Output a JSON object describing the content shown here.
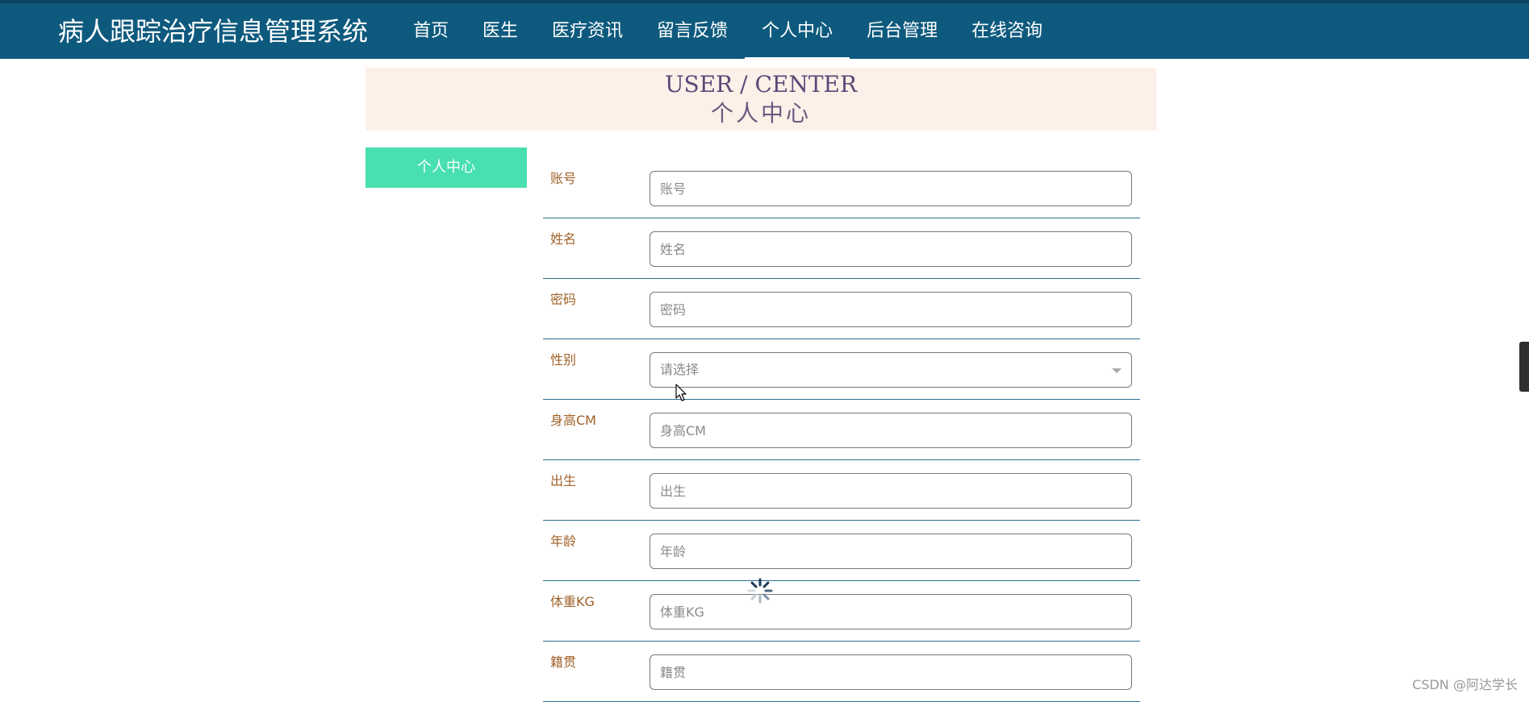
{
  "header": {
    "title": "病人跟踪治疗信息管理系统",
    "nav": [
      {
        "label": "首页"
      },
      {
        "label": "医生"
      },
      {
        "label": "医疗资讯"
      },
      {
        "label": "留言反馈"
      },
      {
        "label": "个人中心"
      },
      {
        "label": "后台管理"
      },
      {
        "label": "在线咨询"
      }
    ],
    "active_nav": "个人中心"
  },
  "banner": {
    "title_en": "USER / CENTER",
    "title_cn": "个人中心"
  },
  "side_menu": {
    "items": [
      {
        "label": "个人中心"
      }
    ]
  },
  "form": {
    "fields": [
      {
        "label": "账号",
        "placeholder": "账号",
        "value": ""
      },
      {
        "label": "姓名",
        "placeholder": "姓名",
        "value": ""
      },
      {
        "label": "密码",
        "placeholder": "密码",
        "value": ""
      },
      {
        "label": "性别",
        "placeholder": "请选择",
        "value": ""
      },
      {
        "label": "身高CM",
        "placeholder": "身高CM",
        "value": ""
      },
      {
        "label": "出生",
        "placeholder": "出生",
        "value": ""
      },
      {
        "label": "年龄",
        "placeholder": "年龄",
        "value": ""
      },
      {
        "label": "体重KG",
        "placeholder": "体重KG",
        "value": ""
      },
      {
        "label": "籍贯",
        "placeholder": "籍贯",
        "value": ""
      }
    ]
  },
  "watermark": "CSDN @阿达学长",
  "icons": {
    "dropdown": "chevron-down-icon",
    "loading": "loading-spinner-icon",
    "pointer": "mouse-cursor-icon"
  },
  "colors": {
    "header_bg": "#0e5a7e",
    "banner_bg": "#fcf0e9",
    "menu_accent": "#48e0b0",
    "label_text": "#a0622a",
    "row_divider": "#2a6f8f"
  }
}
